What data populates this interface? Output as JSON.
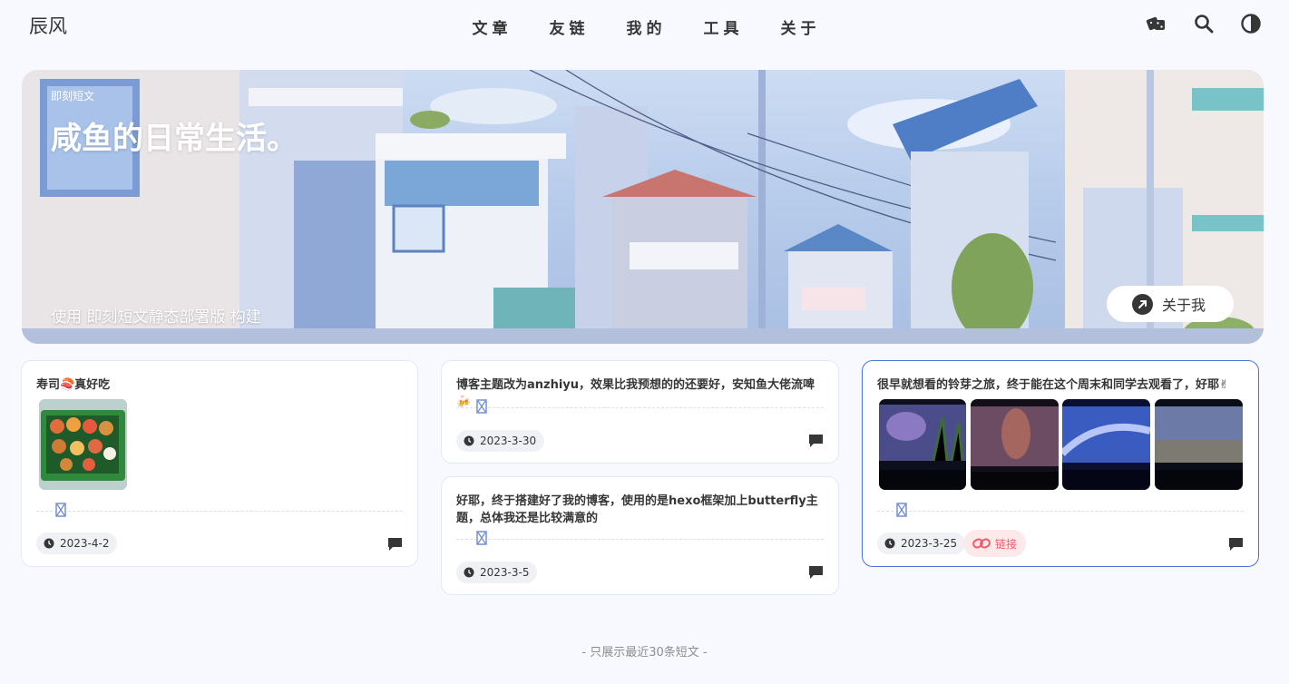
{
  "nav": {
    "brand": "辰风",
    "menu": [
      "文章",
      "友链",
      "我的",
      "工具",
      "关于"
    ],
    "icons": [
      "dice-icon",
      "search-icon",
      "theme-toggle-icon"
    ]
  },
  "banner": {
    "tag": "即刻短文",
    "title": "咸鱼的日常生活。",
    "desc": "使用 即刻短文静态部署版 构建",
    "about_label": "关于我"
  },
  "cards": [
    {
      "text": "寿司🍣真好吃",
      "date": "2023-4-2"
    },
    {
      "text": "博客主题改为anzhiyu，效果比我预想的的还要好，安知鱼大佬流啤🍻",
      "date": "2023-3-30"
    },
    {
      "text": "好耶，终于搭建好了我的博客，使用的是hexo框架加上butterfly主题，总体我还是比较满意的",
      "date": "2023-3-5"
    },
    {
      "text": "很早就想看的铃芽之旅，终于能在这个周末和同学去观看了，好耶✌",
      "date": "2023-3-25",
      "link_label": "链接"
    }
  ],
  "footer": "- 只展示最近30条短文 -",
  "colors": {
    "background": "#f7f9fe",
    "text": "#363636",
    "active_border": "#4a75d8",
    "link": "#f25a6a"
  }
}
